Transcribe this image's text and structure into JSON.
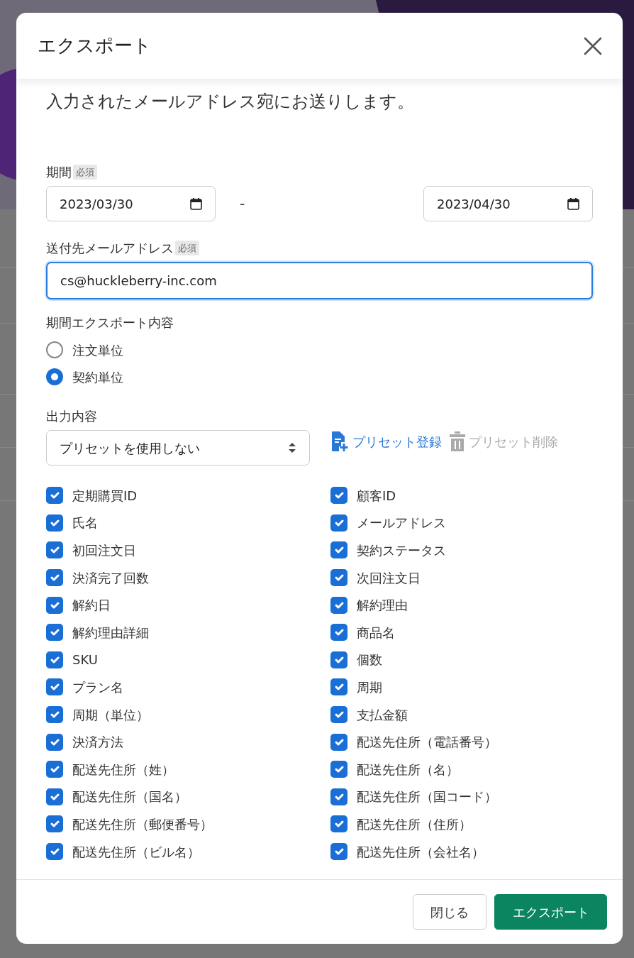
{
  "dialog": {
    "title": "エクスポート",
    "intro": "入力されたメールアドレス宛にお送りします。",
    "period": {
      "label": "期間",
      "required": "必須",
      "start": "2023/03/30",
      "separator": "-",
      "end": "2023/04/30"
    },
    "email": {
      "label": "送付先メールアドレス",
      "required": "必須",
      "value": "cs@huckleberry-inc.com",
      "focused": true
    },
    "export_unit": {
      "label": "期間エクスポート内容",
      "options": [
        {
          "label": "注文単位",
          "selected": false
        },
        {
          "label": "契約単位",
          "selected": true
        }
      ]
    },
    "output": {
      "label": "出力内容",
      "preset": "プリセットを使用しない",
      "actions": [
        {
          "kind": "register",
          "label": "プリセット登録",
          "disabled": false
        },
        {
          "kind": "delete",
          "label": "プリセット削除",
          "disabled": true
        }
      ]
    },
    "fields": [
      {
        "label": "定期購買ID",
        "checked": true
      },
      {
        "label": "顧客ID",
        "checked": true
      },
      {
        "label": "氏名",
        "checked": true
      },
      {
        "label": "メールアドレス",
        "checked": true
      },
      {
        "label": "初回注文日",
        "checked": true
      },
      {
        "label": "契約ステータス",
        "checked": true
      },
      {
        "label": "決済完了回数",
        "checked": true
      },
      {
        "label": "次回注文日",
        "checked": true
      },
      {
        "label": "解約日",
        "checked": true
      },
      {
        "label": "解約理由",
        "checked": true
      },
      {
        "label": "解約理由詳細",
        "checked": true
      },
      {
        "label": "商品名",
        "checked": true
      },
      {
        "label": "SKU",
        "checked": true
      },
      {
        "label": "個数",
        "checked": true
      },
      {
        "label": "プラン名",
        "checked": true
      },
      {
        "label": "周期",
        "checked": true
      },
      {
        "label": "周期（単位）",
        "checked": true
      },
      {
        "label": "支払金額",
        "checked": true
      },
      {
        "label": "決済方法",
        "checked": true
      },
      {
        "label": "配送先住所（電話番号）",
        "checked": true
      },
      {
        "label": "配送先住所（姓）",
        "checked": true
      },
      {
        "label": "配送先住所（名）",
        "checked": true
      },
      {
        "label": "配送先住所（国名）",
        "checked": true
      },
      {
        "label": "配送先住所（国コード）",
        "checked": true
      },
      {
        "label": "配送先住所（郵便番号）",
        "checked": true
      },
      {
        "label": "配送先住所（住所）",
        "checked": true
      },
      {
        "label": "配送先住所（ビル名）",
        "checked": true
      },
      {
        "label": "配送先住所（会社名）",
        "checked": true
      }
    ],
    "buttons": [
      {
        "kind": "secondary",
        "label": "閉じる"
      },
      {
        "kind": "primary",
        "label": "エクスポート"
      }
    ]
  }
}
